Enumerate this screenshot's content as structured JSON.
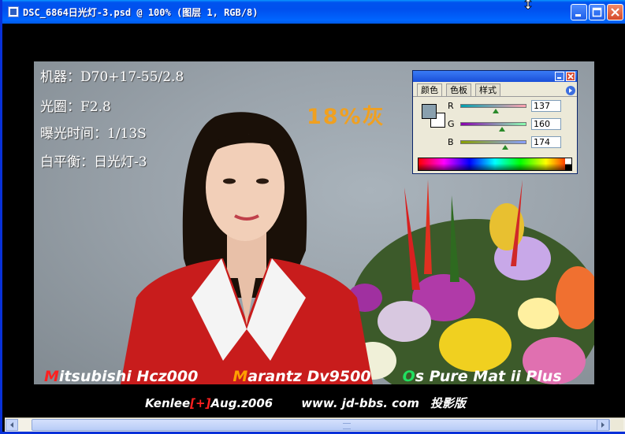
{
  "window": {
    "title": "DSC_6864日光灯-3.psd @ 100% (图层 1, RGB/8)",
    "minimize_icon": "minimize-icon",
    "maximize_icon": "maximize-icon",
    "close_icon": "close-icon"
  },
  "image_text": {
    "camera": "机器：D70+17-55/2.8",
    "aperture": "光圈：F2.8",
    "exposure": "曝光时间：1/13S",
    "white_balance": "白平衡：日光灯-3",
    "gray_label": "18%灰",
    "projector_line": [
      {
        "cap": "M",
        "rest": "itsubishi Hcz000",
        "cap_color": "#ff2020"
      },
      {
        "cap": "M",
        "rest": "arantz Dv9500",
        "cap_color": "#ffa000"
      },
      {
        "cap": "O",
        "rest": "s Pure Mat ii Plus",
        "cap_color": "#20e060"
      }
    ],
    "credit_name": "Kenlee",
    "credit_mark": "[+]",
    "credit_date": "Aug.z006",
    "credit_site": "www. jd-bbs. com",
    "credit_tag": "投影版"
  },
  "color_palette": {
    "tabs": [
      {
        "label": "颜色",
        "active": true
      },
      {
        "label": "色板",
        "active": false
      },
      {
        "label": "样式",
        "active": false
      }
    ],
    "foreground_color": "#89a0ae",
    "background_color": "#ffffff",
    "channels": [
      {
        "label": "R",
        "value": "137",
        "fraction": 0.537
      },
      {
        "label": "G",
        "value": "160",
        "fraction": 0.627
      },
      {
        "label": "B",
        "value": "174",
        "fraction": 0.682
      }
    ]
  }
}
